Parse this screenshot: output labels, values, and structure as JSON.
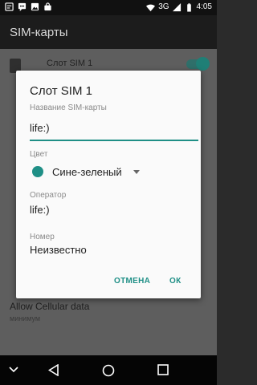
{
  "status_bar": {
    "network": "3G",
    "time": "4:05",
    "left_icons": [
      "notification-icon",
      "chat-icon",
      "image-icon",
      "bag-icon"
    ],
    "right_icons": [
      "wifi-icon",
      "signal-icon",
      "battery-icon"
    ]
  },
  "app_bar": {
    "title": "SIM-карты"
  },
  "background_list": {
    "sim_row_title": "Слот SIM 1",
    "sim_enabled": true,
    "cellular_data": {
      "title": "Allow Cellular data",
      "subtitle": "минимум"
    }
  },
  "dialog": {
    "title": "Слот SIM 1",
    "name_label": "Название SIM-карты",
    "name_value": "life:)",
    "color_label": "Цвет",
    "color_value": "Сине-зеленый",
    "color_swatch": "#1f8f86",
    "operator_label": "Оператор",
    "operator_value": "life:)",
    "number_label": "Номер",
    "number_value": "Неизвестно",
    "cancel_label": "ОТМЕНА",
    "ok_label": "ОК"
  },
  "nav_bar": {
    "icons": [
      "collapse-keyboard-icon",
      "back-icon",
      "home-icon",
      "recents-icon"
    ]
  },
  "colors": {
    "accent": "#1f8f86",
    "dialog_bg": "#fafafa",
    "scrim": "#5e5e5e"
  }
}
